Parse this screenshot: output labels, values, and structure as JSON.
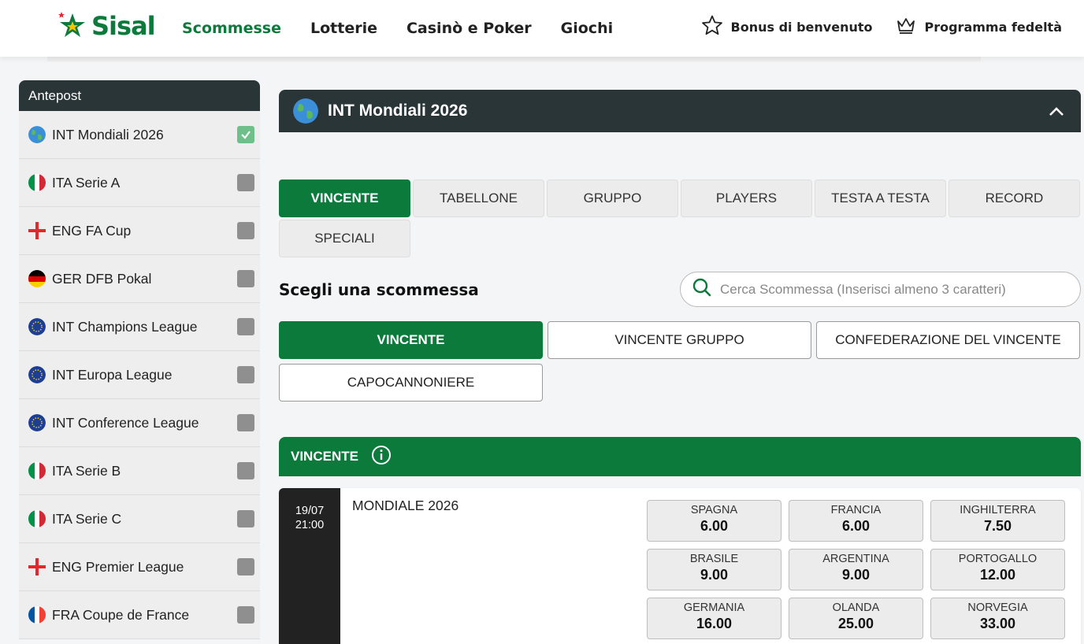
{
  "header": {
    "logo_text": "Sisal",
    "nav": [
      "Scommesse",
      "Lotterie",
      "Casinò e Poker",
      "Giochi"
    ],
    "bonus_label": "Bonus di benvenuto",
    "loyalty_label": "Programma fedeltà"
  },
  "sidebar": {
    "title": "Antepost",
    "items": [
      {
        "label": "INT Mondiali 2026",
        "flag": "globe-icon",
        "checked": true
      },
      {
        "label": "ITA Serie A",
        "flag": "italy-flag-icon",
        "checked": false
      },
      {
        "label": "ENG FA Cup",
        "flag": "england-flag-icon",
        "checked": false
      },
      {
        "label": "GER DFB Pokal",
        "flag": "germany-flag-icon",
        "checked": false
      },
      {
        "label": "INT Champions League",
        "flag": "eu-flag-icon",
        "checked": false
      },
      {
        "label": "INT Europa League",
        "flag": "eu-flag-icon",
        "checked": false
      },
      {
        "label": "INT Conference League",
        "flag": "eu-flag-icon",
        "checked": false
      },
      {
        "label": "ITA Serie B",
        "flag": "italy-flag-icon",
        "checked": false
      },
      {
        "label": "ITA Serie C",
        "flag": "italy-flag-icon",
        "checked": false
      },
      {
        "label": "ENG Premier League",
        "flag": "england-flag-icon",
        "checked": false
      },
      {
        "label": "FRA Coupe de France",
        "flag": "france-flag-icon",
        "checked": false
      }
    ]
  },
  "main": {
    "event_title": "INT Mondiali 2026",
    "tabs": [
      "VINCENTE",
      "TABELLONE",
      "GRUPPO",
      "PLAYERS",
      "TESTA A TESTA",
      "RECORD",
      "SPECIALI"
    ],
    "choose_title": "Scegli una scommessa",
    "search_placeholder": "Cerca Scommessa (Inserisci almeno 3 caratteri)",
    "bet_types": [
      "VINCENTE",
      "VINCENTE GRUPPO",
      "CONFEDERAZIONE DEL VINCENTE",
      "CAPOCANNONIERE"
    ],
    "market_title": "VINCENTE",
    "event": {
      "date": "19/07",
      "time": "21:00",
      "name": "MONDIALE 2026",
      "odds": [
        {
          "team": "SPAGNA",
          "value": "6.00"
        },
        {
          "team": "FRANCIA",
          "value": "6.00"
        },
        {
          "team": "INGHILTERRA",
          "value": "7.50"
        },
        {
          "team": "BRASILE",
          "value": "9.00"
        },
        {
          "team": "ARGENTINA",
          "value": "9.00"
        },
        {
          "team": "PORTOGALLO",
          "value": "12.00"
        },
        {
          "team": "GERMANIA",
          "value": "16.00"
        },
        {
          "team": "OLANDA",
          "value": "25.00"
        },
        {
          "team": "NORVEGIA",
          "value": "33.00"
        }
      ]
    }
  },
  "colors": {
    "brand_green": "#0b7a3b",
    "dark_header": "#2a3538",
    "checked_green": "#6fbf8a",
    "unchecked_grey": "#8f8f8f"
  }
}
